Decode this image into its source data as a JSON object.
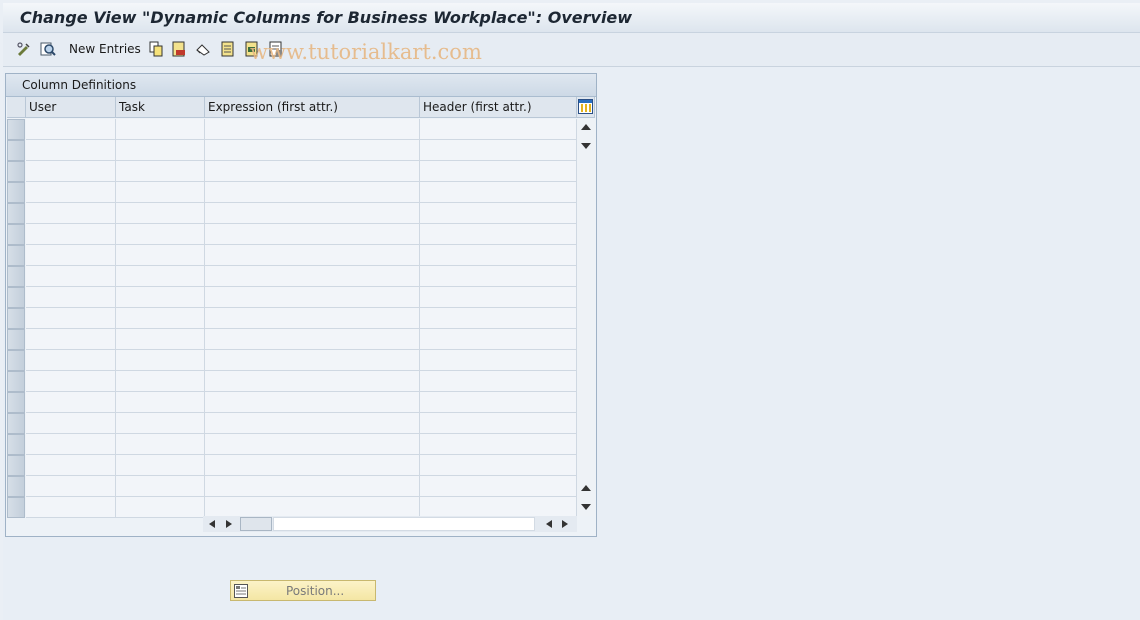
{
  "window": {
    "title": "Change View \"Dynamic Columns for Business Workplace\": Overview"
  },
  "toolbar": {
    "new_entries_label": "New Entries",
    "watermark": "www.tutorialkart.com",
    "icons": [
      "display-change-icon",
      "find-icon",
      "copy-icon",
      "delete-icon",
      "undo-icon",
      "select-all-icon",
      "select-block-icon",
      "deselect-all-icon"
    ]
  },
  "panel": {
    "title": "Column Definitions",
    "columns": [
      "User",
      "Task",
      "Expression (first attr.)",
      "Header (first attr.)"
    ],
    "rows": [
      [
        "",
        "",
        "",
        ""
      ],
      [
        "",
        "",
        "",
        ""
      ],
      [
        "",
        "",
        "",
        ""
      ],
      [
        "",
        "",
        "",
        ""
      ],
      [
        "",
        "",
        "",
        ""
      ],
      [
        "",
        "",
        "",
        ""
      ],
      [
        "",
        "",
        "",
        ""
      ],
      [
        "",
        "",
        "",
        ""
      ],
      [
        "",
        "",
        "",
        ""
      ],
      [
        "",
        "",
        "",
        ""
      ],
      [
        "",
        "",
        "",
        ""
      ],
      [
        "",
        "",
        "",
        ""
      ],
      [
        "",
        "",
        "",
        ""
      ],
      [
        "",
        "",
        "",
        ""
      ],
      [
        "",
        "",
        "",
        ""
      ],
      [
        "",
        "",
        "",
        ""
      ],
      [
        "",
        "",
        "",
        ""
      ],
      [
        "",
        "",
        "",
        ""
      ],
      [
        "",
        "",
        "",
        ""
      ]
    ]
  },
  "footer": {
    "position_label": "Position..."
  },
  "colors": {
    "accent_yellow": "#f4e6a4",
    "panel_border": "#9fb2c6",
    "background": "#eaeff5"
  }
}
